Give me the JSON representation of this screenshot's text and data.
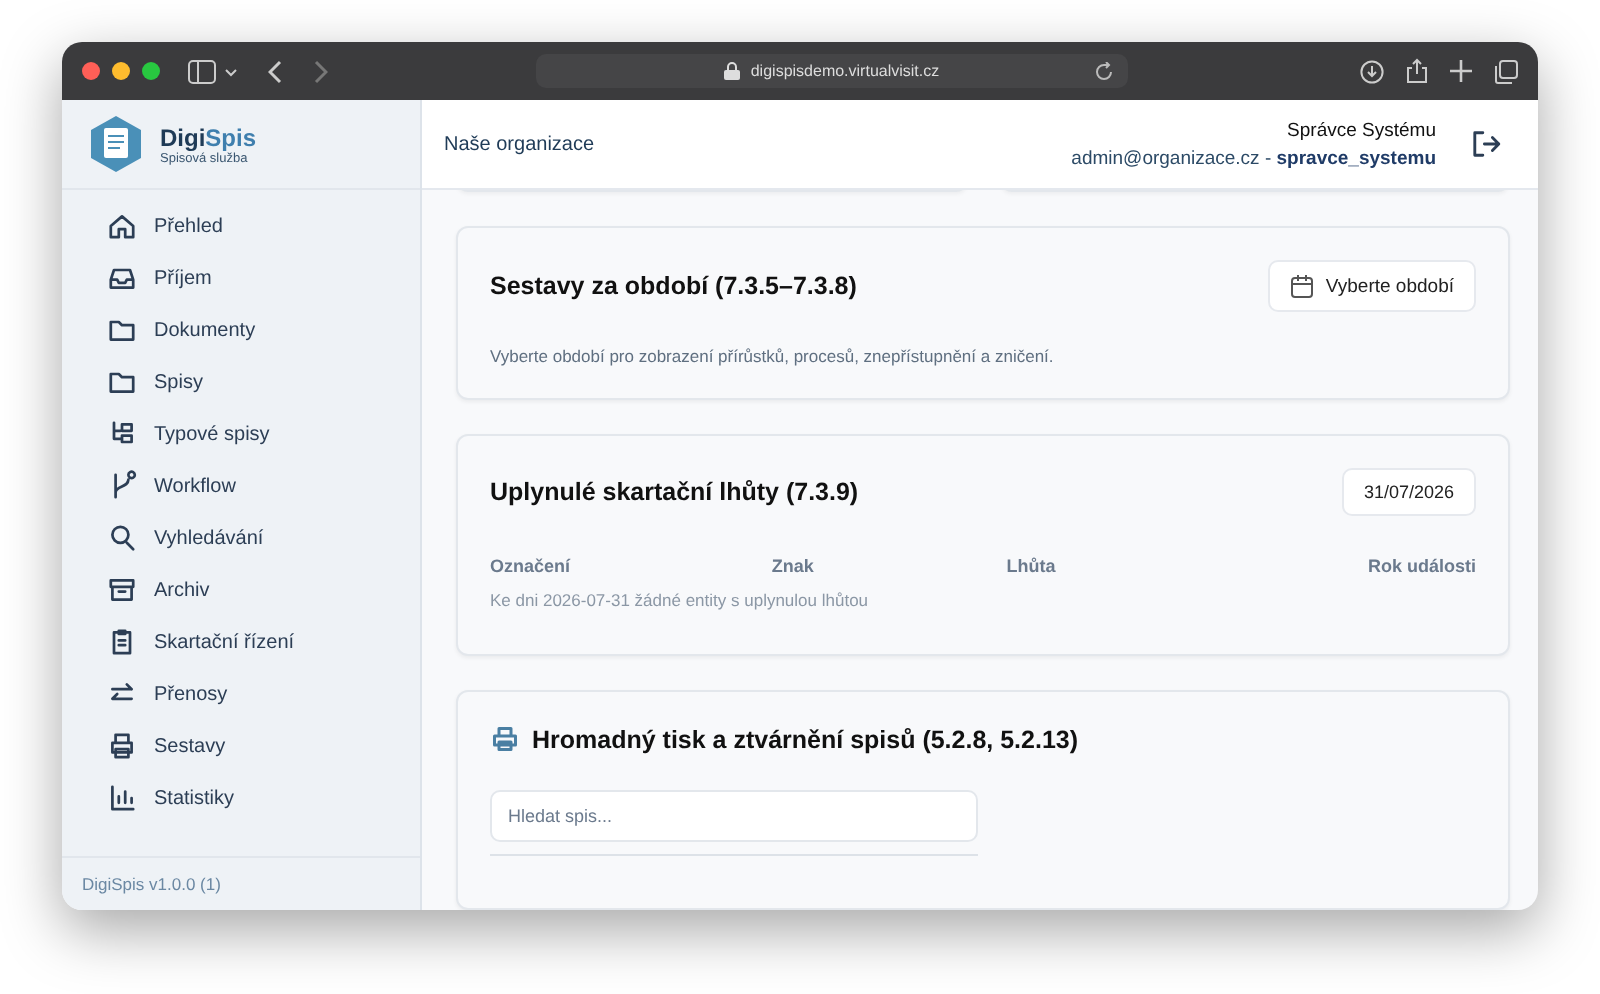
{
  "browser": {
    "url": "digispisdemo.virtualvisit.cz"
  },
  "sidebar": {
    "brand": "Digi",
    "brand_accent": "Spis",
    "tagline": "Spisová služba",
    "items": [
      {
        "label": "Přehled"
      },
      {
        "label": "Příjem"
      },
      {
        "label": "Dokumenty"
      },
      {
        "label": "Spisy"
      },
      {
        "label": "Typové spisy"
      },
      {
        "label": "Workflow"
      },
      {
        "label": "Vyhledávání"
      },
      {
        "label": "Archiv"
      },
      {
        "label": "Skartační řízení"
      },
      {
        "label": "Přenosy"
      },
      {
        "label": "Sestavy"
      },
      {
        "label": "Statistiky"
      }
    ],
    "version": "DigiSpis v1.0.0 (1)"
  },
  "header": {
    "organization": "Naše organizace",
    "user_name": "Správce Systému",
    "user_line": "admin@organizace.cz - **spravce_systemu**"
  },
  "period_reports": {
    "title": "Sestavy za období (7.3.5–7.3.8)",
    "button": "Vyberte období",
    "description": "Vyberte období pro zobrazení přírůstků, procesů, znepřístupnění a zničení."
  },
  "expired_periods": {
    "title": "Uplynulé skartační lhůty (7.3.9)",
    "date": "31/07/2026",
    "columns": [
      "Označení",
      "Znak",
      "Lhůta",
      "Rok události"
    ],
    "empty_text": "Ke dni 2026-07-31 žádné entity s uplynulou lhůtou"
  },
  "bulk_print": {
    "title": "Hromadný tisk a ztvárnění spisů (5.2.8, 5.2.13)",
    "search": {
      "placeholder": "Hledat spis..."
    }
  }
}
